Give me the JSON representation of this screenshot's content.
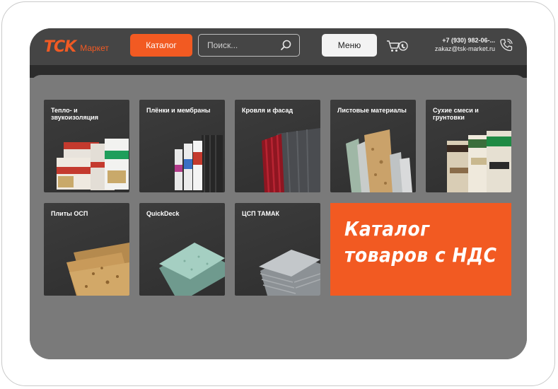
{
  "header": {
    "logo_mark": "TCK",
    "logo_text": "Маркет",
    "catalog_label": "Каталог",
    "search_placeholder": "Поиск...",
    "menu_label": "Меню",
    "phone": "+7 (930) 982-06-...",
    "email": "zakaz@tsk-market.ru"
  },
  "categories": [
    {
      "label": "Тепло- и звукоизоляция"
    },
    {
      "label": "Плёнки и мембраны"
    },
    {
      "label": "Кровля и фасад"
    },
    {
      "label": "Листовые материалы"
    },
    {
      "label": "Сухие смеси и грунтовки"
    },
    {
      "label": "Плиты ОСП"
    },
    {
      "label": "QuickDeck"
    },
    {
      "label": "ЦСП ТАМАК"
    }
  ],
  "banner": {
    "line1": "Каталог",
    "line2": "товаров с НДС"
  },
  "colors": {
    "accent": "#f25a22",
    "header_bg": "#454545",
    "panel_bg": "#7a7a7a",
    "tile_bg": "#363636"
  },
  "icons": [
    "search-icon",
    "cart-icon",
    "phone-icon"
  ]
}
